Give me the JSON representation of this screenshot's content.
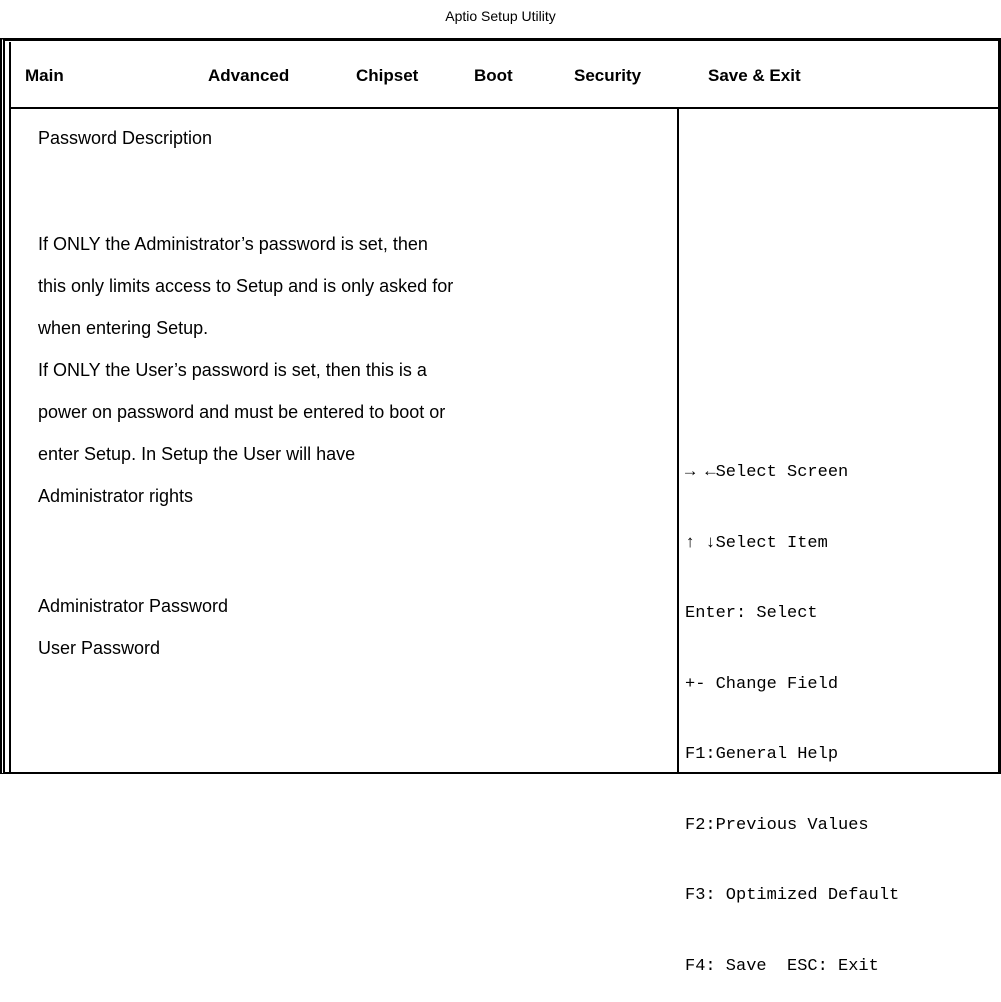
{
  "window": {
    "title": "Aptio Setup Utility"
  },
  "menu": {
    "tabs": [
      {
        "label": "Main"
      },
      {
        "label": "Advanced"
      },
      {
        "label": "Chipset"
      },
      {
        "label": "Boot"
      },
      {
        "label": "Security"
      },
      {
        "label": "Save & Exit"
      }
    ]
  },
  "security": {
    "heading": "Password Description",
    "description_lines": [
      "If ONLY the Administrator’s password is set, then",
      "this only limits access to Setup and is only asked for",
      "when entering Setup.",
      "If ONLY the User’s password is set, then this is a",
      "power on password and must be entered to boot or",
      "enter Setup. In Setup the User will have",
      "Administrator rights"
    ],
    "items": [
      {
        "label": "Administrator Password"
      },
      {
        "label": "User Password"
      }
    ]
  },
  "help": {
    "lines": [
      "→ ←Select Screen",
      "↑ ↓Select Item",
      "Enter: Select",
      "+- Change Field",
      "F1:General Help",
      "F2:Previous Values",
      "F3: Optimized Default",
      "F4: Save  ESC: Exit"
    ]
  }
}
